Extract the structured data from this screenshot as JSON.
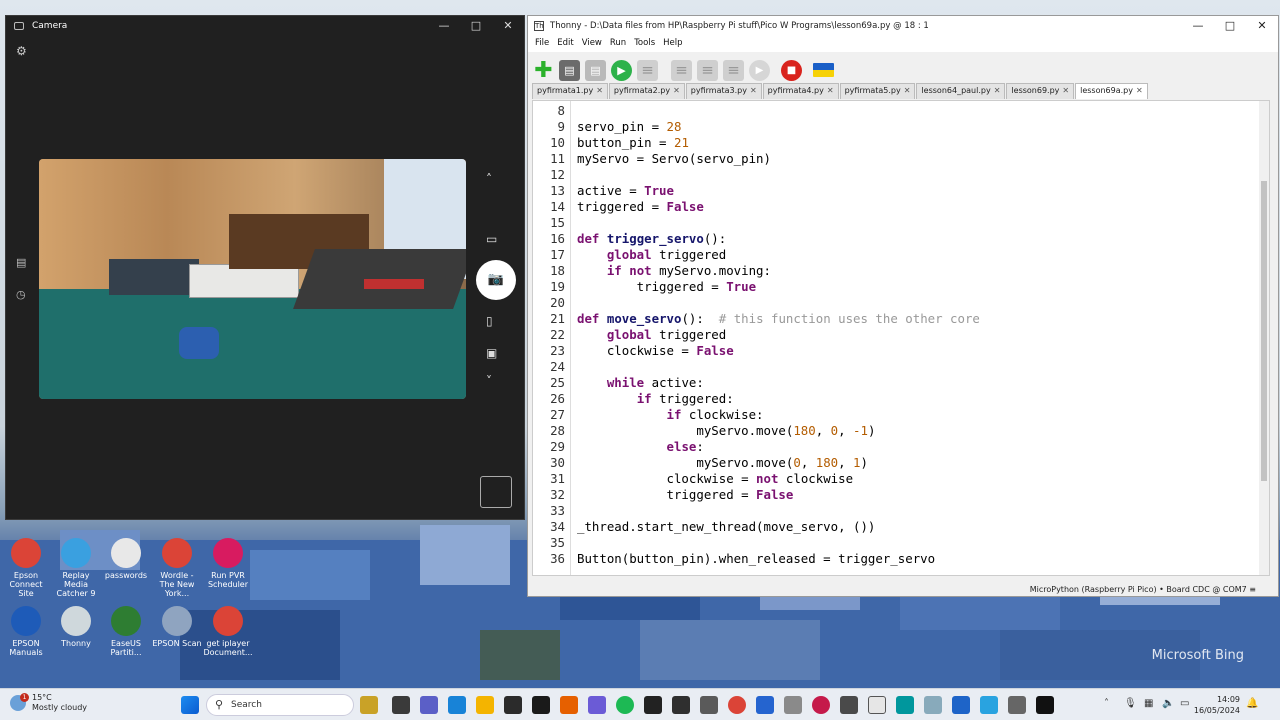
{
  "camera": {
    "title": "Camera",
    "controls": {
      "minimize": "—",
      "maximize": "□",
      "close": "✕"
    }
  },
  "thonny": {
    "title": "Thonny  -  D:\\Data files from HP\\Raspberry Pi stuff\\Pico W Programs\\lesson69a.py  @  18 : 1",
    "controls": {
      "minimize": "—",
      "maximize": "□",
      "close": "✕"
    },
    "menu": [
      "File",
      "Edit",
      "View",
      "Run",
      "Tools",
      "Help"
    ],
    "tabs": [
      {
        "label": "pyfirmata1.py",
        "active": false
      },
      {
        "label": "pyfirmata2.py",
        "active": false
      },
      {
        "label": "pyfirmata3.py",
        "active": false
      },
      {
        "label": "pyfirmata4.py",
        "active": false
      },
      {
        "label": "pyfirmata5.py",
        "active": false
      },
      {
        "label": "lesson64_paul.py",
        "active": false
      },
      {
        "label": "lesson69.py",
        "active": false
      },
      {
        "label": "lesson69a.py",
        "active": true
      }
    ],
    "tab_close": "✕",
    "code": [
      {
        "n": "8",
        "html": ""
      },
      {
        "n": "9",
        "html": "servo_pin = <span class='num'>28</span>"
      },
      {
        "n": "10",
        "html": "button_pin = <span class='num'>21</span>"
      },
      {
        "n": "11",
        "html": "myServo = Servo(servo_pin)"
      },
      {
        "n": "12",
        "html": ""
      },
      {
        "n": "13",
        "html": "active = <span class='kw'>True</span>"
      },
      {
        "n": "14",
        "html": "triggered = <span class='kw'>False</span>"
      },
      {
        "n": "15",
        "html": ""
      },
      {
        "n": "16",
        "html": "<span class='kw'>def</span> <span class='fn'>trigger_servo</span>():"
      },
      {
        "n": "17",
        "html": "    <span class='kw'>global</span> triggered"
      },
      {
        "n": "18",
        "html": "    <span class='kw'>if</span> <span class='kw'>not</span> myServo.moving:"
      },
      {
        "n": "19",
        "html": "        triggered = <span class='kw'>True</span>"
      },
      {
        "n": "20",
        "html": ""
      },
      {
        "n": "21",
        "html": "<span class='kw'>def</span> <span class='fn'>move_servo</span>():  <span class='cm'># this function uses the other core</span>"
      },
      {
        "n": "22",
        "html": "    <span class='kw'>global</span> triggered"
      },
      {
        "n": "23",
        "html": "    clockwise = <span class='kw'>False</span>"
      },
      {
        "n": "24",
        "html": ""
      },
      {
        "n": "25",
        "html": "    <span class='kw'>while</span> active:"
      },
      {
        "n": "26",
        "html": "        <span class='kw'>if</span> triggered:"
      },
      {
        "n": "27",
        "html": "            <span class='kw'>if</span> clockwise:"
      },
      {
        "n": "28",
        "html": "                myServo.move(<span class='num'>180</span>, <span class='num'>0</span>, <span class='num'>-1</span>)"
      },
      {
        "n": "29",
        "html": "            <span class='kw'>else</span>:"
      },
      {
        "n": "30",
        "html": "                myServo.move(<span class='num'>0</span>, <span class='num'>180</span>, <span class='num'>1</span>)"
      },
      {
        "n": "31",
        "html": "            clockwise = <span class='kw'>not</span> clockwise"
      },
      {
        "n": "32",
        "html": "            triggered = <span class='kw'>False</span>"
      },
      {
        "n": "33",
        "html": ""
      },
      {
        "n": "34",
        "html": "_thread.start_new_thread(move_servo, ())"
      },
      {
        "n": "35",
        "html": ""
      },
      {
        "n": "36",
        "html": "Button(button_pin).when_released = trigger_servo"
      }
    ],
    "status": "MicroPython (Raspberry Pi Pico)  •  Board CDC @ COM7 ≡"
  },
  "desktop_icons": [
    {
      "label": "Epson Connect Site",
      "color": "#db4437"
    },
    {
      "label": "Replay Media Catcher 9",
      "color": "#3aa0e0"
    },
    {
      "label": "passwords",
      "color": "#e8e8e8"
    },
    {
      "label": "Wordle - The New York...",
      "color": "#db4437"
    },
    {
      "label": "Run PVR Scheduler",
      "color": "#d81b60"
    },
    {
      "label": "EPSON Manuals",
      "color": "#1e5bb8"
    },
    {
      "label": "Thonny",
      "color": "#cfd8dc"
    },
    {
      "label": "EaseUS Partiti...",
      "color": "#2e7d32"
    },
    {
      "label": "EPSON Scan",
      "color": "#8fa4c0"
    },
    {
      "label": "get iplayer Document...",
      "color": "#db4437"
    }
  ],
  "weather": {
    "temp": "15°C",
    "desc": "Mostly cloudy",
    "badge": "1"
  },
  "search": {
    "label": "Search"
  },
  "clock": {
    "time": "14:09",
    "date": "16/05/2024"
  },
  "watermark": "Microsoft Bing",
  "colors": {
    "keyword": "#7a1170",
    "number": "#b35c00",
    "comment": "#999999",
    "taskbar": "#e9edf3"
  }
}
